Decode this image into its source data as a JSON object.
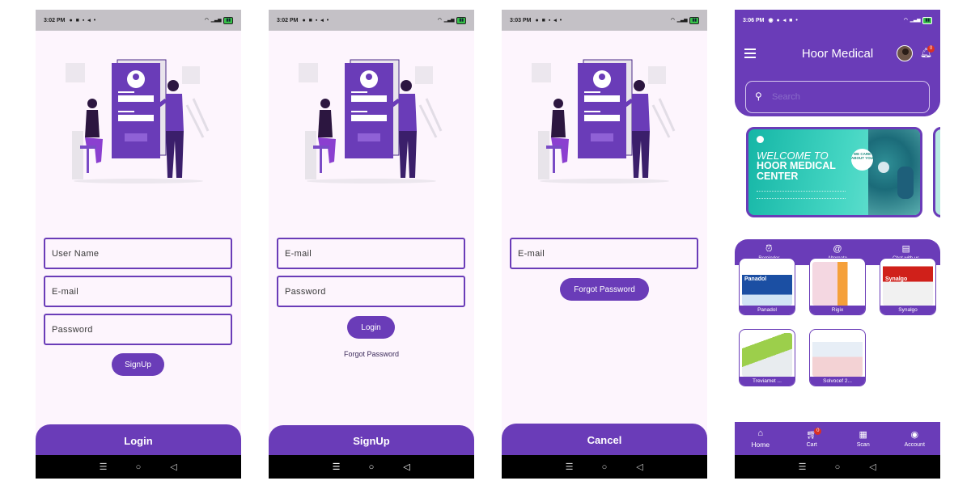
{
  "colors": {
    "primary": "#6a3cb8",
    "screen_bg": "#fdf5fd",
    "status_bar": "#c4c1c6",
    "nav_bar": "#000000",
    "badge": "#d93025"
  },
  "screens": [
    {
      "status": {
        "time": "3:02 PM"
      },
      "fields": [
        {
          "placeholder": "User Name"
        },
        {
          "placeholder": "E-mail"
        },
        {
          "placeholder": "Password"
        }
      ],
      "primary_button": "SignUp",
      "bottom_button": "Login"
    },
    {
      "status": {
        "time": "3:02 PM"
      },
      "fields": [
        {
          "placeholder": "E-mail"
        },
        {
          "placeholder": "Password"
        }
      ],
      "primary_button": "Login",
      "link": "Forgot Password",
      "bottom_button": "SignUp"
    },
    {
      "status": {
        "time": "3:03 PM"
      },
      "fields": [
        {
          "placeholder": "E-mail"
        }
      ],
      "primary_button": "Forgot Password",
      "bottom_button": "Cancel"
    },
    {
      "status": {
        "time": "3:06 PM"
      },
      "header": {
        "title": "Hoor Medical",
        "notification_count": "0"
      },
      "search": {
        "placeholder": "Search",
        "icon": "search-icon"
      },
      "banner": {
        "welcome_line": "WELCOME TO",
        "headline_lines": [
          "HOOR MEDICAL",
          "CENTER"
        ],
        "care_badge": "WE CARE ABOUT YOU"
      },
      "quick_actions": [
        {
          "label": "Reminder",
          "icon": "alarm-icon"
        },
        {
          "label": "Alternate",
          "icon": "at-icon"
        },
        {
          "label": "Chat with us",
          "icon": "chat-icon"
        }
      ],
      "products": [
        {
          "name": "Panadol",
          "brand": "Panadol"
        },
        {
          "name": "Rigix",
          "brand": ""
        },
        {
          "name": "Synalgo",
          "brand": "Synalgo"
        },
        {
          "name": "Treviamet ...",
          "brand": ""
        },
        {
          "name": "Solvocef 2...",
          "brand": ""
        }
      ],
      "bottom_nav": [
        {
          "label": "Home",
          "icon": "home-icon",
          "active": true
        },
        {
          "label": "Cart",
          "icon": "cart-icon",
          "badge": "0"
        },
        {
          "label": "Scan",
          "icon": "qr-scan-icon"
        },
        {
          "label": "Account",
          "icon": "account-icon"
        }
      ]
    }
  ],
  "system_nav": {
    "icons": [
      "recent-apps-icon",
      "home-circle-icon",
      "back-icon"
    ]
  }
}
